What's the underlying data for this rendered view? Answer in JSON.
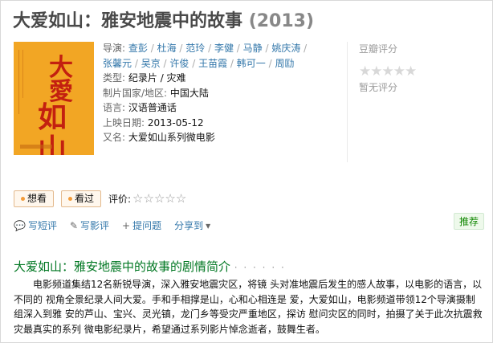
{
  "title": {
    "name": "大爱如山：雅安地震中的故事",
    "year": "(2013)"
  },
  "poster": {
    "alt_chars_top": "大愛",
    "alt_chars_bottom": "如山"
  },
  "info": {
    "director_label": "导演:",
    "directors": [
      "查彭",
      "杜海",
      "范玲",
      "李健",
      "马静",
      "姚庆涛",
      "张馨元",
      "吴京",
      "许俊",
      "王苗霞",
      "韩可一",
      "周劻"
    ],
    "genre_label": "类型:",
    "genre_value": "纪录片 / 灾难",
    "country_label": "制片国家/地区:",
    "country_value": "中国大陆",
    "language_label": "语言:",
    "language_value": "汉语普通话",
    "release_label": "上映日期:",
    "release_value": "2013-05-12",
    "aka_label": "又名:",
    "aka_value": "大爱如山系列微电影"
  },
  "rating": {
    "title": "豆瓣评分",
    "stars": "★★★★★",
    "none_text": "暂无评分"
  },
  "buttons": {
    "want": "想看",
    "seen": "看过"
  },
  "rate_line": {
    "label": "评价:",
    "stars": "☆☆☆☆☆"
  },
  "actions": {
    "short_review": "写短评",
    "review": "写影评",
    "ask": "提问题",
    "share": "分享到"
  },
  "recommend": "推荐",
  "synopsis": {
    "title": "大爱如山：雅安地震中的故事的剧情简介",
    "dots": "· · · · · ·",
    "text": "电影频道集结12名新锐导演，深入雅安地震灾区，将镜 头对准地震后发生的感人故事，以电影的语言，以不同的 视角全景纪录人间大爱。手和手相撑是山，心和心相连是 爱，大爱如山，电影频道带领12个导演摄制组深入到雅 安的芦山、宝兴、灵光镇，龙门乡等受灾严重地区，探访 慰问灾区的同时，拍摄了关于此次抗震救灾最真实的系列 微电影纪录片，希望通过系列影片悼念逝者，鼓舞生者。"
  },
  "colors": {
    "link": "#3377aa",
    "green": "#007722",
    "poster_bg": "#f2a624",
    "poster_text": "#c32010"
  }
}
